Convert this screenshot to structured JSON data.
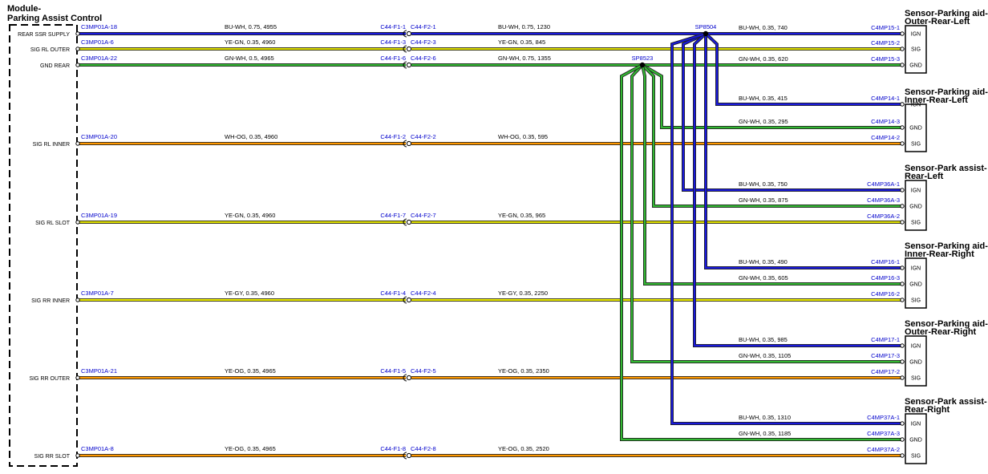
{
  "module": {
    "title_line1": "Module-",
    "title_line2": "Parking Assist Control",
    "pins": [
      "REAR SSR SUPPLY",
      "SIG RL OUTER",
      "GND REAR",
      "SIG RL INNER",
      "SIG RL SLOT",
      "SIG RR INNER",
      "SIG RR OUTER",
      "SIG RR SLOT"
    ]
  },
  "colors": {
    "BU-WH": "#1a1adc",
    "YE-GN": "#e0e000",
    "GN-WH": "#33b833",
    "WH-OG": "#ff9900",
    "YE-GY": "#f0f000",
    "YE-OG": "#ff9900",
    "splice": "#000000"
  },
  "main_wires": [
    {
      "pin": "REAR SSR SUPPLY",
      "left_conn": "C3MP01A-18",
      "left_spec": "BU-WH,  0.75,  4955",
      "conn_a": "C44-F1-1",
      "conn_b": "C44-F2-1",
      "right_spec": "BU-WH,  0.75,  1230",
      "color": "BU-WH"
    },
    {
      "pin": "SIG RL OUTER",
      "left_conn": "C3MP01A-6",
      "left_spec": "YE-GN,  0.35,  4960",
      "conn_a": "C44-F1-3",
      "conn_b": "C44-F2-3",
      "right_spec": "YE-GN,  0.35,  845",
      "color": "YE-GN"
    },
    {
      "pin": "GND REAR",
      "left_conn": "C3MP01A-22",
      "left_spec": "GN-WH,  0.5,  4965",
      "conn_a": "C44-F1-6",
      "conn_b": "C44-F2-6",
      "right_spec": "GN-WH,  0.75,  1355",
      "color": "GN-WH"
    },
    {
      "pin": "SIG RL INNER",
      "left_conn": "C3MP01A-20",
      "left_spec": "WH-OG,  0.35,  4960",
      "conn_a": "C44-F1-2",
      "conn_b": "C44-F2-2",
      "right_spec": "WH-OG,  0.35,  595",
      "color": "WH-OG"
    },
    {
      "pin": "SIG RL SLOT",
      "left_conn": "C3MP01A-19",
      "left_spec": "YE-GN,  0.35,  4960",
      "conn_a": "C44-F1-7",
      "conn_b": "C44-F2-7",
      "right_spec": "YE-GN,  0.35,  965",
      "color": "YE-GN"
    },
    {
      "pin": "SIG RR INNER",
      "left_conn": "C3MP01A-7",
      "left_spec": "YE-GY,  0.35,  4960",
      "conn_a": "C44-F1-4",
      "conn_b": "C44-F2-4",
      "right_spec": "YE-GY,  0.35,  2250",
      "color": "YE-GY"
    },
    {
      "pin": "SIG RR OUTER",
      "left_conn": "C3MP01A-21",
      "left_spec": "YE-OG,  0.35,  4965",
      "conn_a": "C44-F1-5",
      "conn_b": "C44-F2-5",
      "right_spec": "YE-OG,  0.35,  2350",
      "color": "YE-OG"
    },
    {
      "pin": "SIG RR SLOT",
      "left_conn": "C3MP01A-8",
      "left_spec": "YE-OG,  0.35,  4965",
      "conn_a": "C44-F1-8",
      "conn_b": "C44-F2-8",
      "right_spec": "YE-OG,  0.35,  2520",
      "color": "YE-OG"
    }
  ],
  "splices": [
    {
      "name": "SP8504"
    },
    {
      "name": "SP8523"
    }
  ],
  "sensors": [
    {
      "title_line1": "Sensor-Parking aid-",
      "title_line2": "Outer-Rear-Left",
      "pins": [
        {
          "label": "IGN",
          "conn": "C4MP15-1",
          "spec": "BU-WH,  0.35,  740"
        },
        {
          "label": "SIG",
          "conn": "C4MP15-2",
          "spec": ""
        },
        {
          "label": "GND",
          "conn": "C4MP15-3",
          "spec": "GN-WH,  0.35,  620"
        }
      ]
    },
    {
      "title_line1": "Sensor-Parking aid-",
      "title_line2": "Inner-Rear-Left",
      "pins": [
        {
          "label": "IGN",
          "conn": "C4MP14-1",
          "spec": "BU-WH,  0.35,  415"
        },
        {
          "label": "GND",
          "conn": "C4MP14-3",
          "spec": "GN-WH,  0.35,  295"
        },
        {
          "label": "SIG",
          "conn": "C4MP14-2",
          "spec": ""
        }
      ]
    },
    {
      "title_line1": "Sensor-Park assist-",
      "title_line2": "Rear-Left",
      "pins": [
        {
          "label": "IGN",
          "conn": "C4MP36A-1",
          "spec": "BU-WH,  0.35,  750"
        },
        {
          "label": "GND",
          "conn": "C4MP36A-3",
          "spec": "GN-WH,  0.35,  875"
        },
        {
          "label": "SIG",
          "conn": "C4MP36A-2",
          "spec": ""
        }
      ]
    },
    {
      "title_line1": "Sensor-Parking aid-",
      "title_line2": "Inner-Rear-Right",
      "pins": [
        {
          "label": "IGN",
          "conn": "C4MP16-1",
          "spec": "BU-WH,  0.35,  490"
        },
        {
          "label": "GND",
          "conn": "C4MP16-3",
          "spec": "GN-WH,  0.35,  605"
        },
        {
          "label": "SIG",
          "conn": "C4MP16-2",
          "spec": ""
        }
      ]
    },
    {
      "title_line1": "Sensor-Parking aid-",
      "title_line2": "Outer-Rear-Right",
      "pins": [
        {
          "label": "IGN",
          "conn": "C4MP17-1",
          "spec": "BU-WH,  0.35,  985"
        },
        {
          "label": "GND",
          "conn": "C4MP17-3",
          "spec": "GN-WH,  0.35,  1105"
        },
        {
          "label": "SIG",
          "conn": "C4MP17-2",
          "spec": ""
        }
      ]
    },
    {
      "title_line1": "Sensor-Park assist-",
      "title_line2": "Rear-Right",
      "pins": [
        {
          "label": "IGN",
          "conn": "C4MP37A-1",
          "spec": "BU-WH,  0.35,  1310"
        },
        {
          "label": "GND",
          "conn": "C4MP37A-3",
          "spec": "GN-WH,  0.35,  1185"
        },
        {
          "label": "SIG",
          "conn": "C4MP37A-2",
          "spec": ""
        }
      ]
    }
  ]
}
